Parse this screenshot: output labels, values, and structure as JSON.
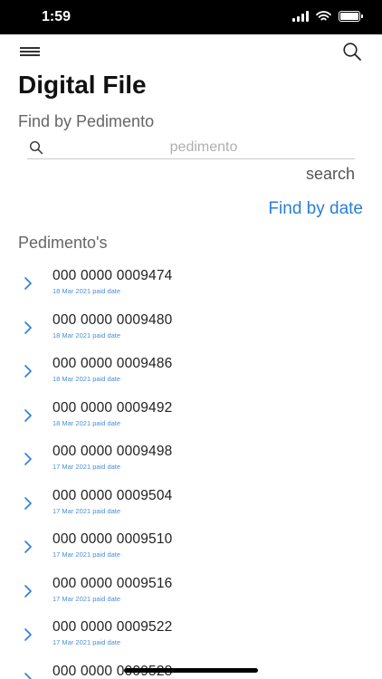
{
  "status": {
    "time": "1:59"
  },
  "header": {
    "title": "Digital File"
  },
  "find_by_pedimento": {
    "label": "Find by Pedimento",
    "placeholder": "pedimento",
    "value": "",
    "search_label": "search"
  },
  "find_by_date_label": "Find by date",
  "list": {
    "label": "Pedimento's",
    "items": [
      {
        "number": "000 0000 0009474",
        "date": "18 Mar 2021 paid date"
      },
      {
        "number": "000 0000 0009480",
        "date": "18 Mar 2021 paid date"
      },
      {
        "number": "000 0000 0009486",
        "date": "18 Mar 2021 paid date"
      },
      {
        "number": "000 0000 0009492",
        "date": "18 Mar 2021 paid date"
      },
      {
        "number": "000 0000 0009498",
        "date": "17 Mar 2021 paid date"
      },
      {
        "number": "000 0000 0009504",
        "date": "17 Mar 2021 paid date"
      },
      {
        "number": "000 0000 0009510",
        "date": "17 Mar 2021 paid date"
      },
      {
        "number": "000 0000 0009516",
        "date": "17 Mar 2021 paid date"
      },
      {
        "number": "000 0000 0009522",
        "date": "17 Mar 2021 paid date"
      },
      {
        "number": "000 0000 0009528",
        "date": ""
      }
    ]
  },
  "colors": {
    "accent": "#2a7fd4",
    "date_text": "#4a8fd6",
    "status_bar": "#000000"
  },
  "icons": {
    "menu": "hamburger-menu-icon",
    "search": "search-icon",
    "row": "chevron-right-icon"
  }
}
